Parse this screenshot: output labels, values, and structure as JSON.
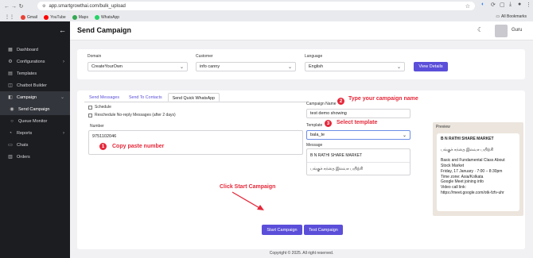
{
  "browser": {
    "url": "app.smartgrowthai.com/bulk_upload",
    "bookmarks": [
      {
        "label": "Gmail",
        "color": "#ea4335"
      },
      {
        "label": "YouTube",
        "color": "#ff0000"
      },
      {
        "label": "Maps",
        "color": "#34a853"
      },
      {
        "label": "WhatsApp",
        "color": "#25d366"
      }
    ],
    "all_bookmarks": "All Bookmarks"
  },
  "sidebar": {
    "items": [
      {
        "label": "Dashboard",
        "icon": "grid-icon"
      },
      {
        "label": "Configurations",
        "icon": "gear-icon"
      },
      {
        "label": "Templates",
        "icon": "template-icon"
      },
      {
        "label": "Chatbot Builder",
        "icon": "chatbot-icon"
      },
      {
        "label": "Campaign",
        "icon": "megaphone-icon"
      },
      {
        "label": "Send Campaign",
        "icon": "send-icon"
      },
      {
        "label": "Queue Monitor",
        "icon": "queue-icon"
      },
      {
        "label": "Reports",
        "icon": "report-icon"
      },
      {
        "label": "Chats",
        "icon": "chat-icon"
      },
      {
        "label": "Orders",
        "icon": "orders-icon"
      }
    ]
  },
  "header": {
    "title": "Send Campaign",
    "user": "Guru"
  },
  "filters": {
    "domain_label": "Domain",
    "domain_value": "CreateYourOwn",
    "customer_label": "Customer",
    "customer_value": "info canny",
    "language_label": "Language",
    "language_value": "English",
    "view_details": "View Details"
  },
  "tabs": [
    "Send Messages",
    "Send To Contacts",
    "Send Quick WhatsApp"
  ],
  "form": {
    "schedule": "Schedule",
    "reschedule": "Reschedule No-reply Messages (after 2 days)",
    "number_label": "Number",
    "number_value": "9751102046",
    "campaign_name_label": "Campaign Name",
    "campaign_name_value": "test demo showing",
    "template_label": "Template",
    "template_value": "bala_te",
    "message_label": "Message",
    "message_lines": [
      "B N RATHI SHARE MARKET",
      "பங்குச் சந்தை இலவச பயிற்சி"
    ],
    "start_campaign": "Start Campaign",
    "test_campaign": "Test Campaign"
  },
  "preview": {
    "title": "Preview",
    "lines": [
      {
        "text": "B N RATHI SHARE MARKET",
        "bold": true
      },
      {
        "text": "",
        "bold": false
      },
      {
        "text": "பங்குச் சந்தை இலவச பயிற்சி",
        "bold": false
      },
      {
        "text": "",
        "bold": false
      },
      {
        "text": "Basic and Fundamental Class About",
        "bold": false
      },
      {
        "text": "Stock Market",
        "bold": false
      },
      {
        "text": "Friday, 17 January · 7:00 – 8:30pm",
        "bold": false
      },
      {
        "text": "Time zone: Asia/Kolkata",
        "bold": false
      },
      {
        "text": "Google Meet joining info",
        "bold": false
      },
      {
        "text": "Video call link:",
        "bold": false
      },
      {
        "text": "https://meet.google.com/otk-fzfv-uhr",
        "bold": false
      }
    ]
  },
  "annotations": {
    "step1": "1",
    "step1_text": "Copy paste number",
    "step2": "2",
    "step2_text": "Type your campaign name",
    "step3": "3",
    "step3_text": "Select template",
    "start_hint": "Click Start Campaign",
    "color": "#e5283a"
  },
  "footer": "Copyright © 2025. All right reserved.",
  "colors": {
    "accent": "#5b4fd9",
    "sidebar": "#1c1d21"
  }
}
